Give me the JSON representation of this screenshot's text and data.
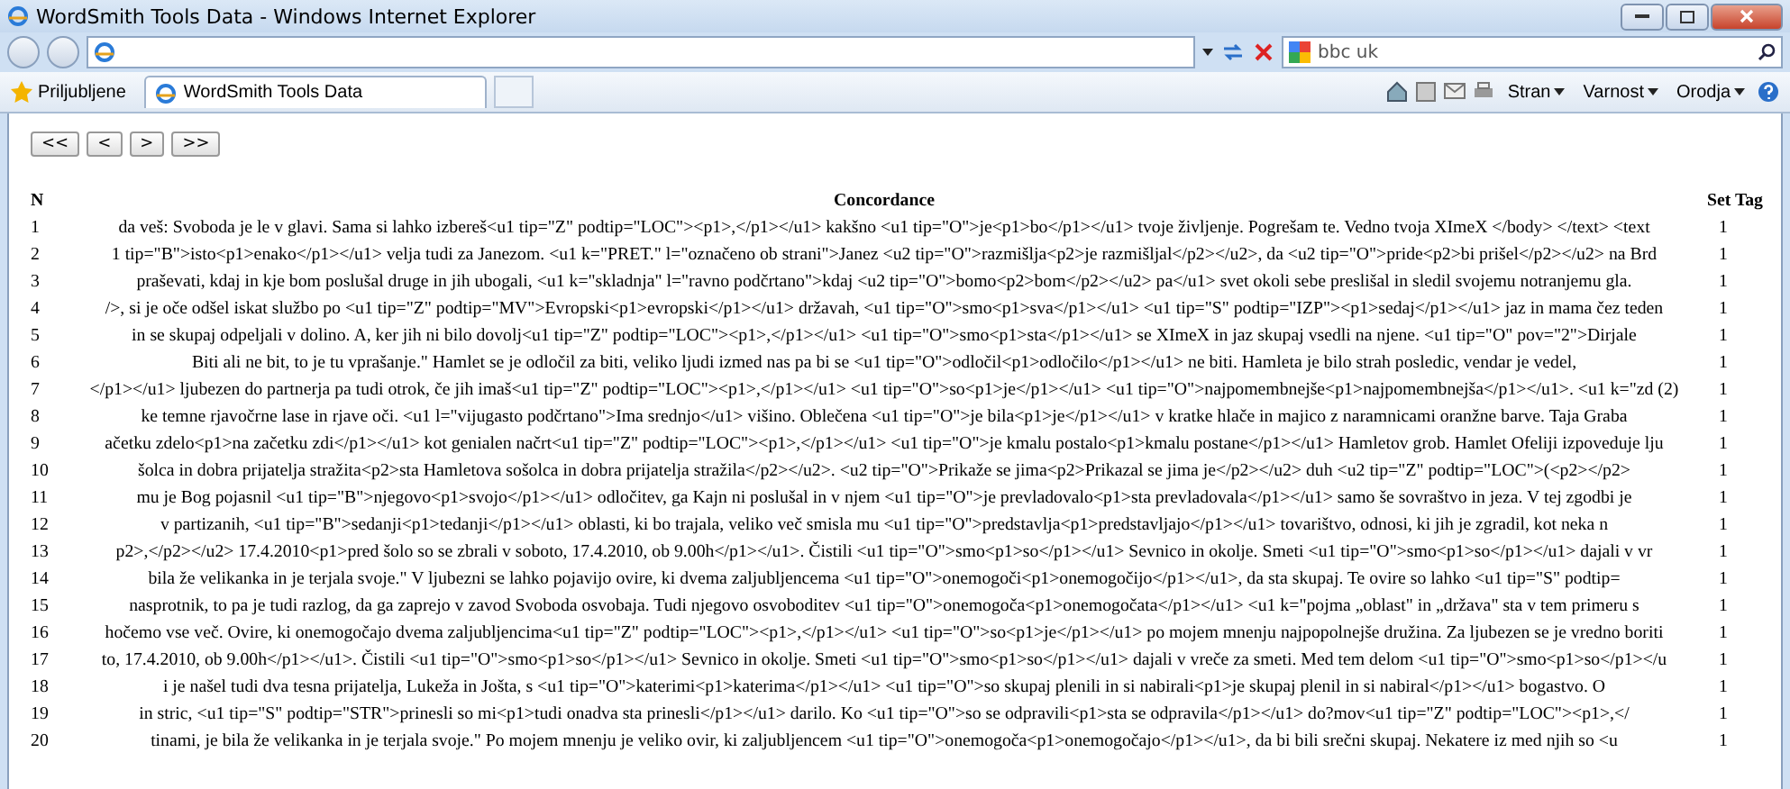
{
  "window": {
    "title": "WordSmith Tools Data - Windows Internet Explorer"
  },
  "address_bar": {
    "search": {
      "value": "bbc uk"
    }
  },
  "favorites": {
    "label": "Priljubljene"
  },
  "tabs": [
    {
      "label": "WordSmith Tools Data",
      "selected": true
    }
  ],
  "command_bar": {
    "menus": [
      "Stran",
      "Varnost",
      "Orodja"
    ]
  },
  "nav_buttons": [
    "<<",
    "<",
    ">",
    ">>"
  ],
  "table": {
    "columns": [
      "N",
      "Concordance",
      "Set Tag"
    ],
    "rows": [
      {
        "n": "1",
        "concordance": "da veš: Svoboda je le v glavi. Sama si lahko izbereš<u1 tip=\"Z\" podtip=\"LOC\"><p1>,</p1></u1> kakšno <u1 tip=\"O\">je<p1>bo</p1></u1> tvoje življenje. Pogrešam te. Vedno tvoja XImeX </body> </text> <text",
        "set_tag": "1"
      },
      {
        "n": "2",
        "concordance": "1 tip=\"B\">isto<p1>enako</p1></u1> velja tudi za Janezom. <u1 k=\"PRET.\" l=\"označeno ob strani\">Janez <u2 tip=\"O\">razmišlja<p2>je razmišljal</p2></u2>, da <u2 tip=\"O\">pride<p2>bi prišel</p2></u2> na Brd",
        "set_tag": "1"
      },
      {
        "n": "3",
        "concordance": "praševati, kdaj in kje bom poslušal druge in jih ubogali, <u1 k=\"skladnja\" l=\"ravno podčrtano\">kdaj <u2 tip=\"O\">bomo<p2>bom</p2></u2> pa</u1> svet okoli sebe preslišal in sledil svojemu notranjemu gla.",
        "set_tag": "1"
      },
      {
        "n": "4",
        "concordance": "/>, si je oče odšel iskat službo po <u1 tip=\"Z\" podtip=\"MV\">Evropski<p1>evropski</p1></u1> državah, <u1 tip=\"O\">smo<p1>sva</p1></u1> <u1 tip=\"S\" podtip=\"IZP\"><p1>sedaj</p1></u1> jaz in mama čez teden",
        "set_tag": "1"
      },
      {
        "n": "5",
        "concordance": "in se skupaj odpeljali v dolino. A, ker jih ni bilo dovolj<u1 tip=\"Z\" podtip=\"LOC\"><p1>,</p1></u1> <u1 tip=\"O\">smo<p1>sta</p1></u1> se XImeX in jaz skupaj vsedli na njene. <u1 tip=\"O\" pov=\"2\">Dirjale",
        "set_tag": "1"
      },
      {
        "n": "6",
        "concordance": "Biti ali ne bit, to je tu vprašanje.\" Hamlet se je odločil za biti, veliko ljudi izmed nas pa bi se <u1 tip=\"O\">odločil<p1>odločilo</p1></u1> ne biti. Hamleta je bilo strah posledic, vendar je vedel,",
        "set_tag": "1"
      },
      {
        "n": "7",
        "concordance": "</p1></u1> ljubezen do partnerja pa tudi otrok, če jih imaš<u1 tip=\"Z\" podtip=\"LOC\"><p1>,</p1></u1> <u1 tip=\"O\">so<p1>je</p1></u1> <u1 tip=\"O\">najpomembnejše<p1>najpomembnejša</p1></u1>. <u1 k=\"zd (2)",
        "set_tag": "1"
      },
      {
        "n": "8",
        "concordance": "ke temne rjavočrne lase in rjave oči. <u1 l=\"vijugasto podčrtano\">Ima srednjo</u1> višino. Oblečena <u1 tip=\"O\">je bila<p1>je</p1></u1> v kratke hlače in majico z naramnicami oranžne barve. Taja Graba",
        "set_tag": "1"
      },
      {
        "n": "9",
        "concordance": "ačetku zdelo<p1>na začetku zdi</p1></u1> kot genialen načrt<u1 tip=\"Z\" podtip=\"LOC\"><p1>,</p1></u1> <u1 tip=\"O\">je kmalu postalo<p1>kmalu postane</p1></u1> Hamletov grob. Hamlet Ofeliji izpoveduje lju",
        "set_tag": "1"
      },
      {
        "n": "10",
        "concordance": "šolca in dobra prijatelja stražita<p2>sta Hamletova sošolca in dobra prijatelja stražila</p2></u2>. <u2 tip=\"O\">Prikaže se jima<p2>Prikazal se jima je</p2></u2> duh <u2 tip=\"Z\" podtip=\"LOC\">(<p2></p2>",
        "set_tag": "1"
      },
      {
        "n": "11",
        "concordance": "mu je Bog pojasnil <u1 tip=\"B\">njegovo<p1>svojo</p1></u1> odločitev, ga Kajn ni poslušal in v njem <u1 tip=\"O\">je prevladovalo<p1>sta prevladovala</p1></u1> samo še sovraštvo in jeza. V tej zgodbi je",
        "set_tag": "1"
      },
      {
        "n": "12",
        "concordance": "v partizanih, <u1 tip=\"B\">sedanji<p1>tedanji</p1></u1> oblasti, ki bo trajala, veliko več smisla mu <u1 tip=\"O\">predstavlja<p1>predstavljajo</p1></u1> tovarištvo, odnosi, ki jih je zgradil, kot neka n",
        "set_tag": "1"
      },
      {
        "n": "13",
        "concordance": "p2>,</p2></u2> 17.4.2010<p1>pred šolo so se zbrali v soboto, 17.4.2010, ob 9.00h</p1></u1>. Čistili <u1 tip=\"O\">smo<p1>so</p1></u1> Sevnico in okolje. Smeti <u1 tip=\"O\">smo<p1>so</p1></u1> dajali v vr",
        "set_tag": "1"
      },
      {
        "n": "14",
        "concordance": "bila že velikanka in je terjala svoje.\" V ljubezni se lahko pojavijo ovire, ki dvema zaljubljencema <u1 tip=\"O\">onemogoči<p1>onemogočijo</p1></u1>, da sta skupaj. Te ovire so lahko <u1 tip=\"S\" podtip=",
        "set_tag": "1"
      },
      {
        "n": "15",
        "concordance": "nasprotnik, to pa je tudi razlog, da ga zaprejo v zavod Svoboda osvobaja. Tudi njegovo osvoboditev <u1 tip=\"O\">onemogoča<p1>onemogočata</p1></u1> <u1 k=\"pojma „oblast\" in „država\" sta v tem primeru s",
        "set_tag": "1"
      },
      {
        "n": "16",
        "concordance": "hočemo vse več. Ovire, ki onemogočajo dvema zaljubljencima<u1 tip=\"Z\" podtip=\"LOC\"><p1>,</p1></u1> <u1 tip=\"O\">so<p1>je</p1></u1> po mojem mnenju najpopolnejše družina. Za ljubezen se je vredno boriti",
        "set_tag": "1"
      },
      {
        "n": "17",
        "concordance": "to, 17.4.2010, ob 9.00h</p1></u1>. Čistili <u1 tip=\"O\">smo<p1>so</p1></u1> Sevnico in okolje. Smeti <u1 tip=\"O\">smo<p1>so</p1></u1> dajali v vreče za smeti. Med tem delom <u1 tip=\"O\">smo<p1>so</p1></u",
        "set_tag": "1"
      },
      {
        "n": "18",
        "concordance": "i je našel tudi dva tesna prijatelja, Lukeža in Jošta, s <u1 tip=\"O\">katerimi<p1>katerima</p1></u1> <u1 tip=\"O\">so skupaj plenili in si nabirali<p1>je skupaj plenil in si nabiral</p1></u1> bogastvo. O",
        "set_tag": "1"
      },
      {
        "n": "19",
        "concordance": "in stric, <u1 tip=\"S\" podtip=\"STR\">prinesli so mi<p1>tudi onadva sta prinesli</p1></u1> darilo. Ko <u1 tip=\"O\">so se odpravili<p1>sta se odpravila</p1></u1> do?mov<u1 tip=\"Z\" podtip=\"LOC\"><p1>,</",
        "set_tag": "1"
      },
      {
        "n": "20",
        "concordance": "tinami, je bila že velikanka in je terjala svoje.\" Po mojem mnenju je veliko ovir, ki zaljubljencem <u1 tip=\"O\">onemogoča<p1>onemogočajo</p1></u1>, da bi bili srečni skupaj. Nekatere iz med njih so <u",
        "set_tag": "1"
      }
    ]
  }
}
